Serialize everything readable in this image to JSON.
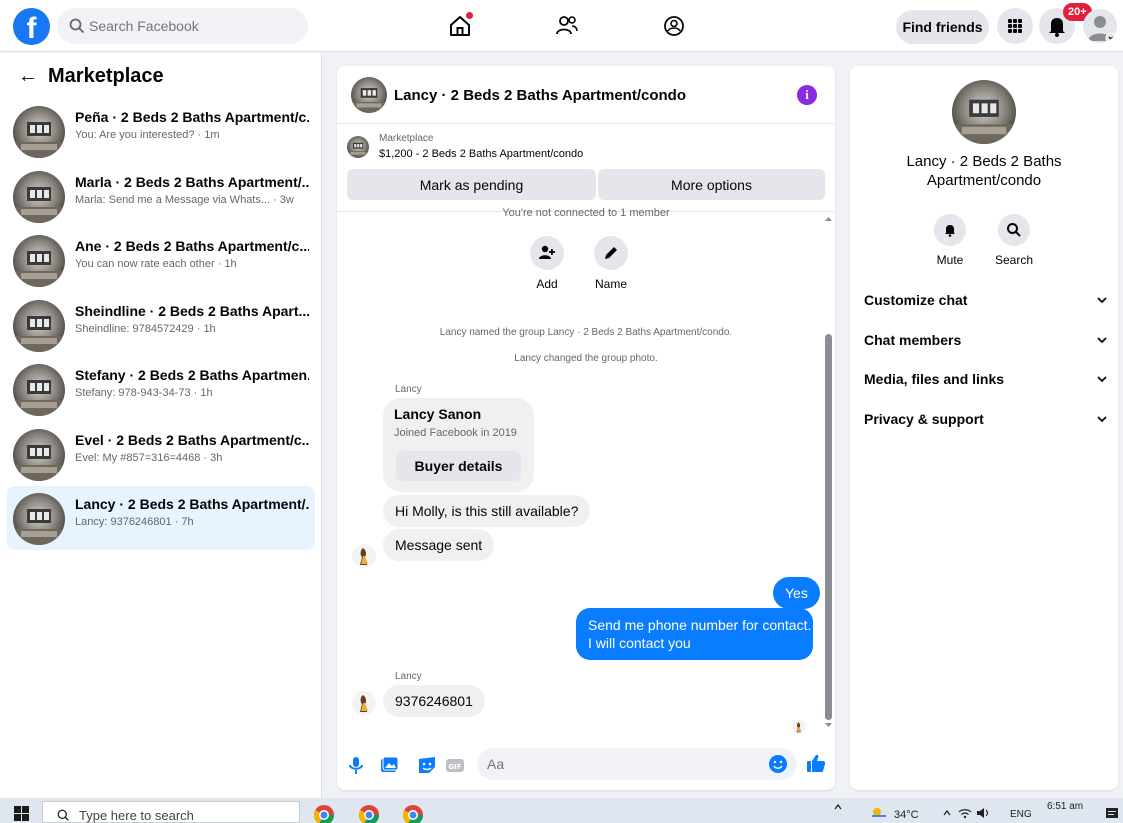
{
  "topbar": {
    "logo": "f",
    "search_placeholder": "Search Facebook",
    "find_friends": "Find friends",
    "notification_count": "20+"
  },
  "marketplace": {
    "title": "Marketplace",
    "back": "←",
    "conversations": [
      {
        "title": "Peña · 2 Beds 2 Baths Apartment/c...",
        "sub": "You: Are you interested? · 1m"
      },
      {
        "title": "Marla · 2 Beds 2 Baths Apartment/...",
        "sub": "Marla: Send me a Message via Whats... · 3w"
      },
      {
        "title": "Ane · 2 Beds 2 Baths Apartment/c...",
        "sub": "You can now rate each other · 1h"
      },
      {
        "title": "Sheindline · 2 Beds 2 Baths Apart...",
        "sub": "Sheindline: 9784572429 · 1h"
      },
      {
        "title": "Stefany · 2 Beds 2 Baths Apartmen...",
        "sub": "Stefany: 978-943-34-73 · 1h"
      },
      {
        "title": "Evel · 2 Beds 2 Baths Apartment/c...",
        "sub": "Evel: My #857=316=4468 · 3h"
      },
      {
        "title": "Lancy · 2 Beds 2 Baths Apartment/...",
        "sub": "Lancy: 9376246801 · 7h",
        "active": true
      }
    ]
  },
  "chat": {
    "title": "Lancy · 2 Beds 2 Baths Apartment/condo",
    "info_icon": "i",
    "marketplace_label": "Marketplace",
    "listing": "$1,200 - 2 Beds 2 Baths Apartment/condo",
    "mark_pending": "Mark as pending",
    "more_options": "More options",
    "not_connected": "You're not connected to 1 member",
    "add_label": "Add",
    "name_label": "Name",
    "sys_named": "Lancy named the group Lancy · 2 Beds 2 Baths Apartment/condo.",
    "sys_photo": "Lancy changed the group photo.",
    "sender1": "Lancy",
    "card_name": "Lancy Sanon",
    "card_joined": "Joined Facebook in 2019",
    "card_button": "Buyer details",
    "msg1": "Hi Molly, is this still available?",
    "msg2": "Message sent",
    "me1": "Yes",
    "me2_line1": "Send me phone number for contact.",
    "me2_line2": "I will contact you",
    "sender2": "Lancy",
    "msg3": "9376246801",
    "composer_placeholder": "Aa"
  },
  "details": {
    "name_line1": "Lancy · 2 Beds 2 Baths",
    "name_line2": "Apartment/condo",
    "mute": "Mute",
    "search": "Search",
    "sections": [
      "Customize chat",
      "Chat members",
      "Media, files and links",
      "Privacy & support"
    ]
  },
  "taskbar": {
    "search_placeholder": "Type here to search",
    "temperature": "34°C",
    "language": "ENG",
    "time": "6:51 am"
  },
  "colors": {
    "accent": "#1877f2",
    "my_bubble": "#0a7cff",
    "info": "#8a2be2",
    "badge": "#e41e3f"
  }
}
